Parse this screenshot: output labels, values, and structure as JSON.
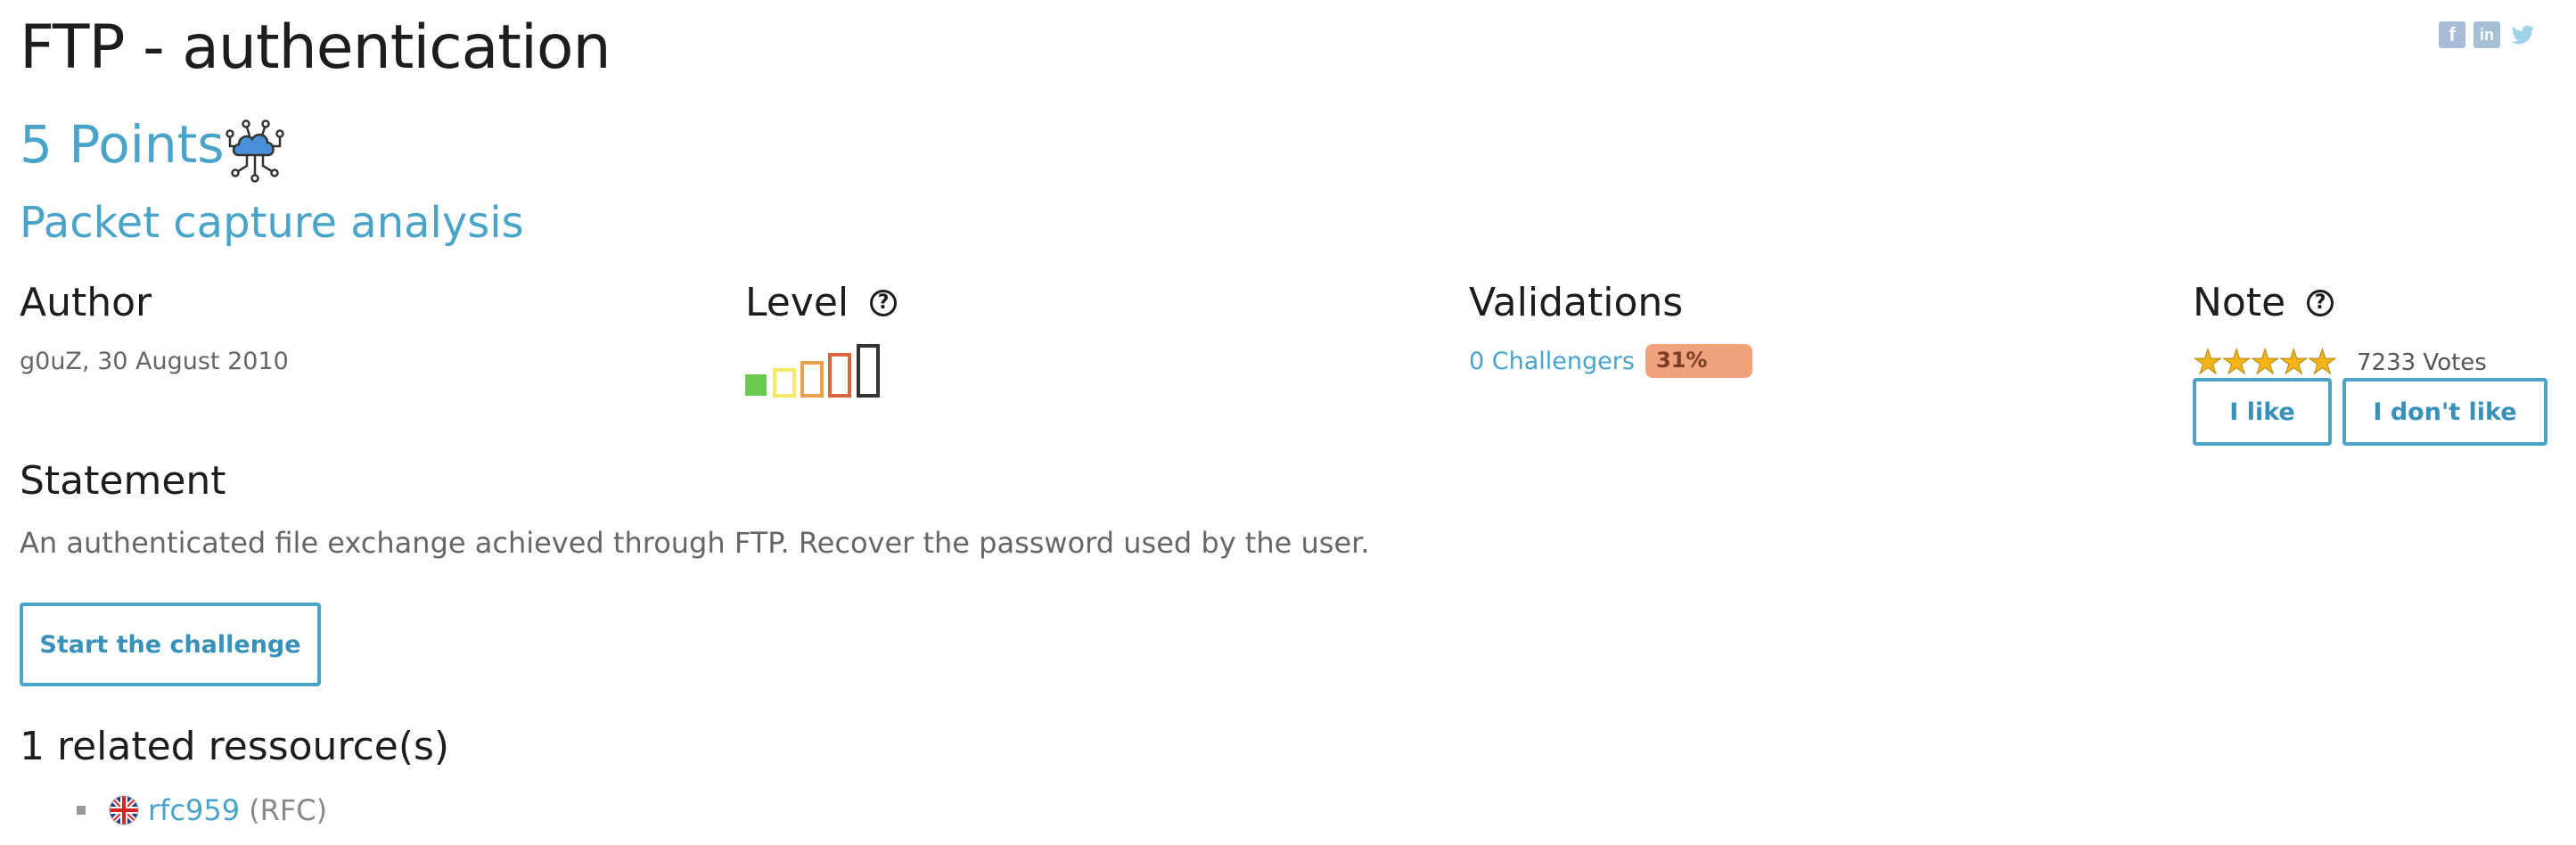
{
  "challenge": {
    "title": "FTP - authentication",
    "points": "5 Points",
    "category": "Packet capture analysis",
    "category_icon": "network-cloud-icon"
  },
  "social": {
    "facebook": "f",
    "linkedin": "in",
    "twitter": "t"
  },
  "author": {
    "heading": "Author",
    "value": "g0uZ,  30 August 2010"
  },
  "level": {
    "heading": "Level",
    "help": "?",
    "current": 1,
    "max": 5,
    "colors": [
      "#6ac94e",
      "#f4ea63",
      "#e9a04b",
      "#d9663f",
      "#333333"
    ]
  },
  "validations": {
    "heading": "Validations",
    "challengers": "0 Challengers",
    "percent_label": "31%",
    "percent": 31,
    "color": "#f0a27c"
  },
  "note": {
    "heading": "Note",
    "help": "?",
    "stars": 5,
    "votes": "7233 Votes",
    "like_label": "I like",
    "dislike_label": "I don't like"
  },
  "statement": {
    "heading": "Statement",
    "text": "An authenticated file exchange achieved through FTP. Recover the password used by the user.",
    "start_label": "Start the challenge"
  },
  "resources": {
    "heading": "1 related ressource(s)",
    "items": [
      {
        "name": "rfc959",
        "type": "(RFC)",
        "flag": "uk-flag-icon"
      }
    ]
  },
  "colors": {
    "accent": "#4aa3c8",
    "text": "#1d1d1d",
    "muted": "#666666"
  }
}
